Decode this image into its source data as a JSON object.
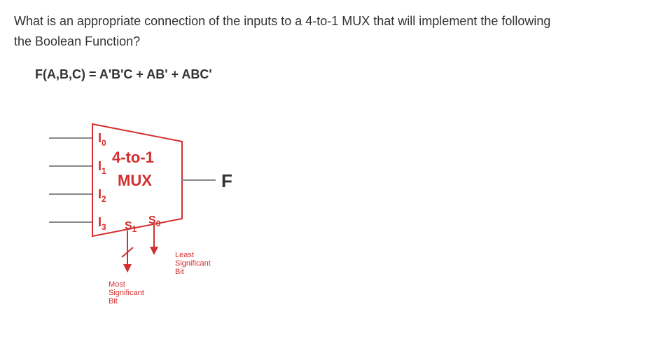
{
  "question_line1": "What is an appropriate connection of the inputs to a 4-to-1 MUX that will implement the following",
  "question_line2": "the Boolean Function?",
  "formula": "F(A,B,C) = A'B'C + AB' + ABC'",
  "mux": {
    "title1": "4-to-1",
    "title2": "MUX",
    "inputs": {
      "i0_main": "I",
      "i0_sub": "0",
      "i1_main": "I",
      "i1_sub": "1",
      "i2_main": "I",
      "i2_sub": "2",
      "i3_main": "I",
      "i3_sub": "3"
    },
    "selects": {
      "s1_main": "S",
      "s1_sub": "1",
      "s0_main": "S",
      "s0_sub": "0"
    },
    "output": "F",
    "msb": "Most\nSignificant\nBit",
    "lsb": "Least\nSignificant\nBit"
  }
}
